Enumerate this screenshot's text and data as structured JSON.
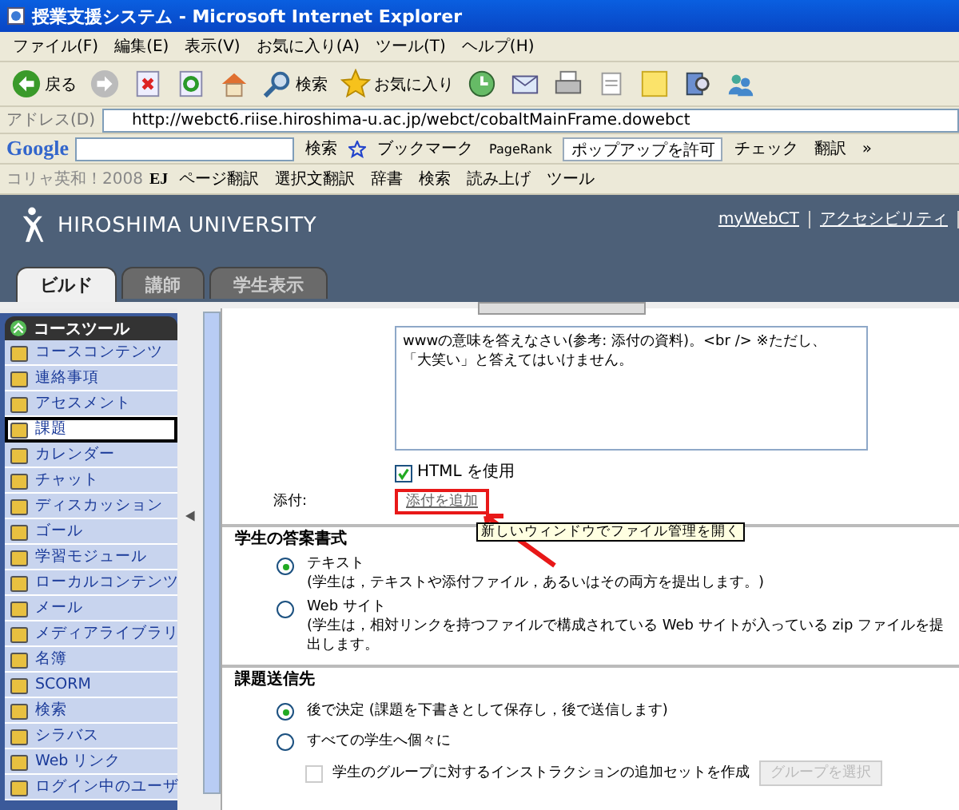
{
  "window": {
    "title": "授業支援システム - Microsoft Internet Explorer"
  },
  "menu": [
    "ファイル(F)",
    "編集(E)",
    "表示(V)",
    "お気に入り(A)",
    "ツール(T)",
    "ヘルプ(H)"
  ],
  "toolbar": [
    {
      "kind": "back",
      "label": "戻る"
    },
    {
      "kind": "forward"
    },
    {
      "kind": "stop"
    },
    {
      "kind": "refresh"
    },
    {
      "kind": "home"
    },
    {
      "kind": "search",
      "label": "検索"
    },
    {
      "kind": "favorites",
      "label": "お気に入り"
    },
    {
      "kind": "history"
    },
    {
      "kind": "mail"
    },
    {
      "kind": "print"
    },
    {
      "kind": "edit"
    },
    {
      "kind": "note"
    },
    {
      "kind": "research"
    },
    {
      "kind": "messenger"
    }
  ],
  "address": {
    "label": "アドレス(D)",
    "value": "http://webct6.riise.hiroshima-u.ac.jp/webct/cobaltMainFrame.dowebct"
  },
  "google_bar": {
    "logo": "Google",
    "search_label": "検索",
    "bookmarks": "ブックマーク",
    "pagerank": "PageRank",
    "popup": "ポップアップを許可",
    "check": "チェック",
    "translate": "翻訳",
    "more": "»"
  },
  "dict_bar": {
    "title": "コリャ英和！2008",
    "logo": "EJ",
    "items": [
      "ページ翻訳",
      "選択文翻訳",
      "辞書",
      "検索",
      "読み上げ",
      "ツール"
    ]
  },
  "header": {
    "university": "HIROSHIMA UNIVERSITY",
    "links": [
      "myWebCT",
      "アクセシビリティ"
    ]
  },
  "tabs": [
    {
      "label": "ビルド",
      "selected": true
    },
    {
      "label": "講師",
      "selected": false
    },
    {
      "label": "学生表示",
      "selected": false
    }
  ],
  "sidebar": {
    "title": "コースツール",
    "items": [
      {
        "label": "コースコンテンツ",
        "selected": false
      },
      {
        "label": "連絡事項",
        "selected": false
      },
      {
        "label": "アセスメント",
        "selected": false
      },
      {
        "label": "課題",
        "selected": true
      },
      {
        "label": "カレンダー",
        "selected": false
      },
      {
        "label": "チャット",
        "selected": false
      },
      {
        "label": "ディスカッション",
        "selected": false
      },
      {
        "label": "ゴール",
        "selected": false
      },
      {
        "label": "学習モジュール",
        "selected": false
      },
      {
        "label": "ローカルコンテンツ",
        "selected": false
      },
      {
        "label": "メール",
        "selected": false
      },
      {
        "label": "メディアライブラリ",
        "selected": false
      },
      {
        "label": "名簿",
        "selected": false
      },
      {
        "label": "SCORM",
        "selected": false
      },
      {
        "label": "検索",
        "selected": false
      },
      {
        "label": "シラバス",
        "selected": false
      },
      {
        "label": "Web リンク",
        "selected": false
      },
      {
        "label": "ログイン中のユーザ",
        "selected": false
      }
    ]
  },
  "editor": {
    "lines": [
      "wwwの意味を答えなさい(参考: 添付の資料)。<br /> ※ただし、",
      "「大笑い」と答えてはいけません。"
    ],
    "use_html": {
      "label": "HTML を使用",
      "checked": true
    }
  },
  "attachment": {
    "label": "添付:",
    "link": "添付を追加",
    "highlighted": true,
    "tooltip": "新しいウィンドウでファイル管理を開く"
  },
  "answer_format": {
    "title": "学生の答案書式",
    "options": [
      {
        "label": "テキスト",
        "description": "(学生は，テキストや添付ファイル，あるいはその両方を提出します。)",
        "selected": true
      },
      {
        "label": "Web サイト",
        "description": "(学生は，相対リンクを持つファイルで構成されている Web サイトが入っている zip ファイルを提出します。",
        "selected": false
      }
    ]
  },
  "submit_to": {
    "title": "課題送信先",
    "options": [
      {
        "label": "後で決定 (課題を下書きとして保存し，後で送信します)",
        "selected": true
      },
      {
        "label": "すべての学生へ個々に",
        "selected": false
      }
    ],
    "group_option": {
      "label": "学生のグループに対するインストラクションの追加セットを作成",
      "checked": false,
      "button": "グループを選択",
      "disabled": true
    }
  }
}
